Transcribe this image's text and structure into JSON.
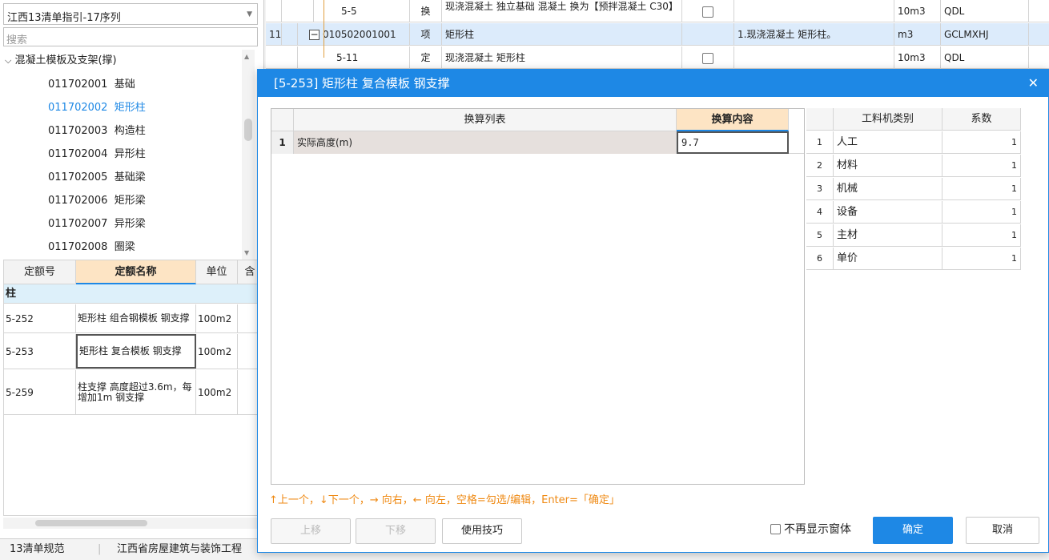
{
  "left_panel": {
    "combo_value": "江西13清单指引-17序列",
    "search_placeholder": "搜索",
    "tree": {
      "group_label": "混凝土模板及支架(撑)",
      "items": [
        {
          "code": "011702001",
          "name": "基础"
        },
        {
          "code": "011702002",
          "name": "矩形柱"
        },
        {
          "code": "011702003",
          "name": "构造柱"
        },
        {
          "code": "011702004",
          "name": "异形柱"
        },
        {
          "code": "011702005",
          "name": "基础梁"
        },
        {
          "code": "011702006",
          "name": "矩形梁"
        },
        {
          "code": "011702007",
          "name": "异形梁"
        },
        {
          "code": "011702008",
          "name": "圈梁"
        }
      ]
    },
    "quota_grid": {
      "headers": [
        "定额号",
        "定额名称",
        "单位",
        "含"
      ],
      "group_label": "柱",
      "rows": [
        {
          "code": "5-252",
          "name": "矩形柱 组合钢模板 钢支撑",
          "unit": "100m2"
        },
        {
          "code": "5-253",
          "name": "矩形柱 复合模板 钢支撑",
          "unit": "100m2"
        },
        {
          "code": "5-259",
          "name": "柱支撑 高度超过3.6m，每增加1m 钢支撑",
          "unit": "100m2"
        }
      ]
    }
  },
  "top_grid": {
    "rows": [
      {
        "no": "",
        "code": "5-5",
        "type": "换",
        "name": "现浇混凝土 独立基础 混凝土 换为【预拌混凝土 C30】",
        "feature": "",
        "unit": "10m3",
        "rule": "QDL"
      },
      {
        "no": "11",
        "code": "010502001001",
        "type": "项",
        "name": "矩形柱",
        "feature": "1.现浇混凝土 矩形柱。",
        "unit": "m3",
        "rule": "GCLMXHJ"
      },
      {
        "no": "",
        "code": "5-11",
        "type": "定",
        "name": "现浇混凝土 矩形柱",
        "feature": "",
        "unit": "10m3",
        "rule": "QDL"
      }
    ]
  },
  "dialog": {
    "title": "[5-253] 矩形柱 复合模板 钢支撑",
    "conv_headers": [
      "换算列表",
      "换算内容"
    ],
    "conv_rows": [
      {
        "idx": "1",
        "name": "实际高度(m)",
        "value": "9.7"
      }
    ],
    "coef_headers": [
      "工料机类别",
      "系数"
    ],
    "coef_rows": [
      {
        "idx": "1",
        "category": "人工",
        "coef": "1"
      },
      {
        "idx": "2",
        "category": "材料",
        "coef": "1"
      },
      {
        "idx": "3",
        "category": "机械",
        "coef": "1"
      },
      {
        "idx": "4",
        "category": "设备",
        "coef": "1"
      },
      {
        "idx": "5",
        "category": "主材",
        "coef": "1"
      },
      {
        "idx": "6",
        "category": "单价",
        "coef": "1"
      }
    ],
    "hint": "↑上一个，↓下一个，→ 向右，← 向左，空格=勾选/编辑，Enter=「确定」",
    "buttons": {
      "move_up": "上移",
      "move_down": "下移",
      "tips": "使用技巧",
      "ok": "确定",
      "cancel": "取消"
    },
    "dont_show_label": "不再显示窗体"
  },
  "status_bar": {
    "spec": "13清单规范",
    "standard": "江西省房屋建筑与装饰工程"
  }
}
